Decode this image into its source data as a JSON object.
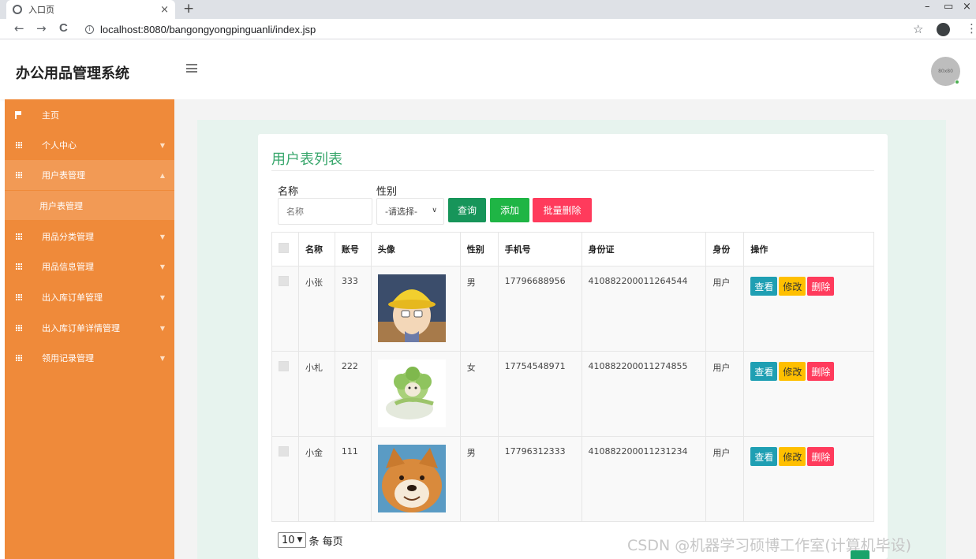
{
  "browser": {
    "tab_title": "入口页",
    "tab_close": "×",
    "new_tab": "+",
    "url": "localhost:8080/bangongyongpinguanli/index.jsp",
    "back": "←",
    "forward": "→",
    "reload": "C",
    "star": "☆",
    "menu": "⋮",
    "minimize": "–",
    "restore": "▭",
    "close": "×"
  },
  "header": {
    "brand": "办公用品管理系统",
    "avatar_text": "80x80"
  },
  "sidebar": {
    "items": [
      {
        "label": "主页",
        "icon": "flag-icon"
      },
      {
        "label": "个人中心",
        "icon": "grid-icon"
      },
      {
        "label": "用户表管理",
        "icon": "grid-icon"
      },
      {
        "label": "用品分类管理",
        "icon": "grid-icon"
      },
      {
        "label": "用品信息管理",
        "icon": "grid-icon"
      },
      {
        "label": "出入库订单管理",
        "icon": "grid-icon"
      },
      {
        "label": "出入库订单详情管理",
        "icon": "grid-icon"
      },
      {
        "label": "领用记录管理",
        "icon": "grid-icon"
      }
    ],
    "sub_item": "用户表管理",
    "colors": {
      "background": "#ef8a3a",
      "active": "#f29a55"
    }
  },
  "main": {
    "title": "用户表列表",
    "filters": {
      "name_label": "名称",
      "name_placeholder": "名称",
      "gender_label": "性别",
      "gender_selected": "-请选择-"
    },
    "buttons": {
      "search": "查询",
      "add": "添加",
      "batch_delete": "批量删除"
    },
    "table": {
      "headers": [
        "名称",
        "账号",
        "头像",
        "性别",
        "手机号",
        "身份证",
        "身份",
        "操作"
      ],
      "rows": [
        {
          "name": "小张",
          "account": "333",
          "avatar": "cartoon-boy-avatar",
          "gender": "男",
          "phone": "17796688956",
          "id_card": "410882200011264544",
          "role": "用户"
        },
        {
          "name": "小札",
          "account": "222",
          "avatar": "cabbage-dog-avatar",
          "gender": "女",
          "phone": "17754548971",
          "id_card": "410882200011274855",
          "role": "用户"
        },
        {
          "name": "小金",
          "account": "111",
          "avatar": "shiba-dog-avatar",
          "gender": "男",
          "phone": "17796312333",
          "id_card": "410882200011231234",
          "role": "用户"
        }
      ],
      "actions": {
        "view": "查看",
        "edit": "修改",
        "delete": "删除"
      }
    },
    "pager": {
      "page_size": "10",
      "per_page_text": "条 每页"
    }
  },
  "watermark": "CSDN @机器学习硕博工作室(计算机毕设)"
}
